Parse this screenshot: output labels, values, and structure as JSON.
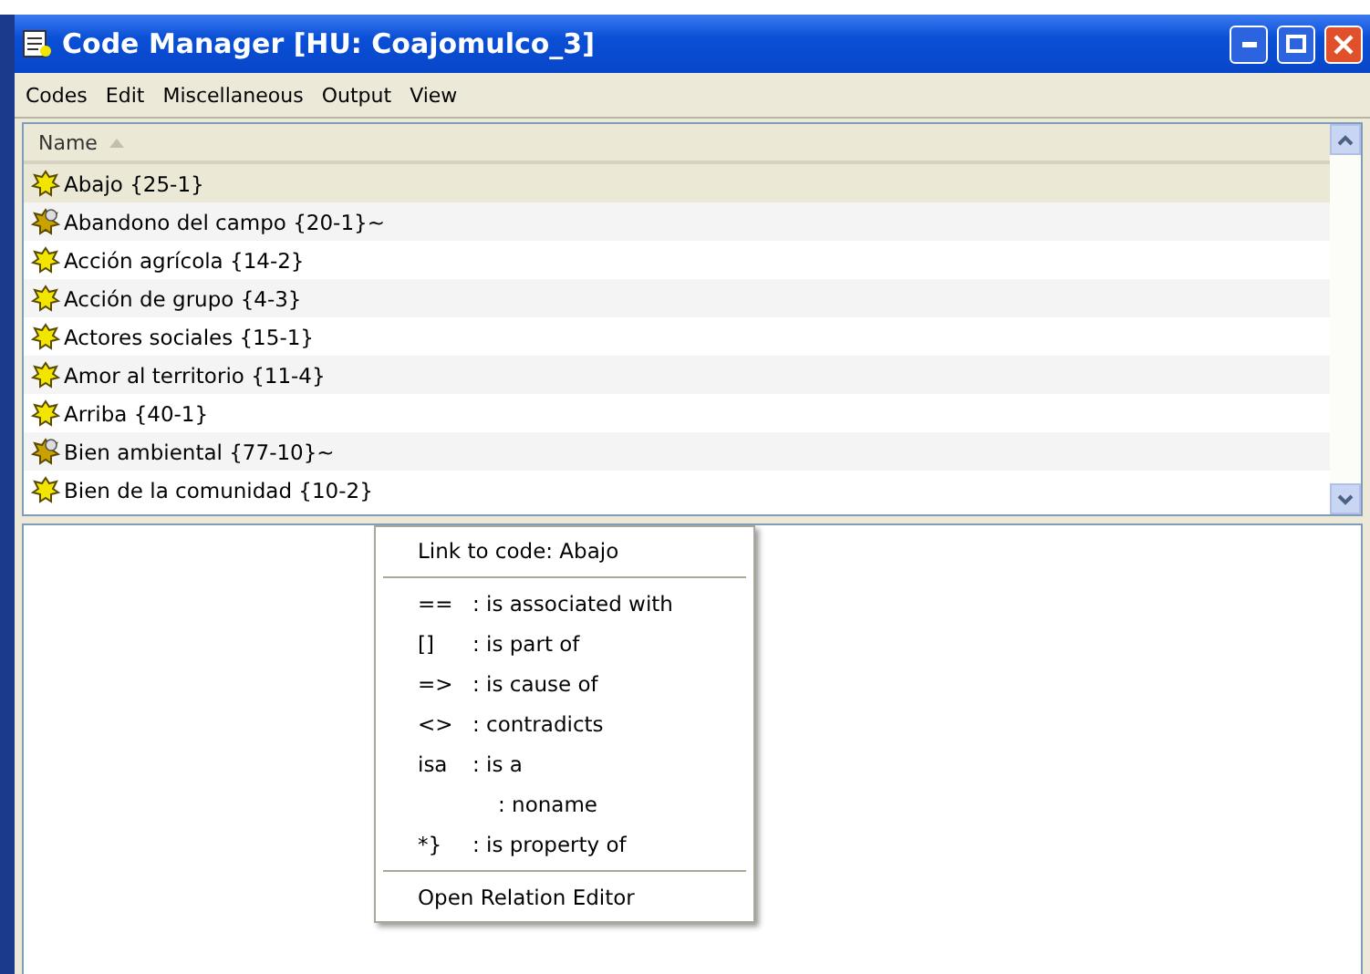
{
  "window": {
    "title": "Code Manager [HU: Coajomulco_3]"
  },
  "menu_bar": [
    "Codes",
    "Edit",
    "Miscellaneous",
    "Output",
    "View"
  ],
  "list": {
    "column": "Name",
    "sorted_ascending": true,
    "rows": [
      {
        "label": "Abajo {25-1}",
        "kind": "code",
        "selected": true
      },
      {
        "label": "Abandono del campo {20-1}~",
        "kind": "commented",
        "selected": false
      },
      {
        "label": "Acción agrícola {14-2}",
        "kind": "code",
        "selected": false
      },
      {
        "label": "Acción de grupo {4-3}",
        "kind": "code",
        "selected": false
      },
      {
        "label": "Actores sociales {15-1}",
        "kind": "code",
        "selected": false
      },
      {
        "label": "Amor al territorio {11-4}",
        "kind": "code",
        "selected": false
      },
      {
        "label": "Arriba {40-1}",
        "kind": "code",
        "selected": false
      },
      {
        "label": "Bien ambiental {77-10}~",
        "kind": "commented",
        "selected": false
      },
      {
        "label": "Bien de la comunidad {10-2}",
        "kind": "code",
        "selected": false
      }
    ]
  },
  "context_menu": [
    {
      "kind": "item",
      "label": "Link to code: Abajo"
    },
    {
      "kind": "separator"
    },
    {
      "kind": "relation",
      "symbol": "==",
      "label": ": is associated with"
    },
    {
      "kind": "relation",
      "symbol": "[]",
      "label": ": is part of"
    },
    {
      "kind": "relation",
      "symbol": "=>",
      "label": ": is cause of"
    },
    {
      "kind": "relation",
      "symbol": "<>",
      "label": ": contradicts"
    },
    {
      "kind": "relation",
      "symbol": "isa",
      "label": ": is a"
    },
    {
      "kind": "relation",
      "label": ": noname"
    },
    {
      "kind": "relation",
      "symbol": "*}",
      "label": ": is property of"
    },
    {
      "kind": "separator"
    },
    {
      "kind": "item",
      "label": "Open Relation Editor"
    }
  ]
}
